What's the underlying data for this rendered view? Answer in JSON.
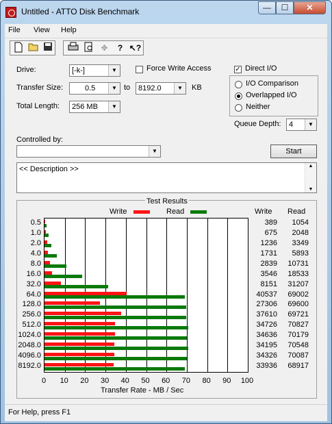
{
  "window": {
    "title": "Untitled - ATTO Disk Benchmark",
    "min": "—",
    "max": "☐",
    "close": "✕"
  },
  "menu": [
    "File",
    "View",
    "Help"
  ],
  "toolbar": {
    "icons": [
      "new-file-icon",
      "open-folder-icon",
      "save-icon",
      "print-icon",
      "print-preview-icon",
      "move-icon",
      "help-icon",
      "context-help-icon"
    ]
  },
  "form": {
    "drive_label": "Drive:",
    "drive_value": "[-k-]",
    "force_write_label": "Force Write Access",
    "force_write_checked": false,
    "direct_io_label": "Direct I/O",
    "direct_io_checked": true,
    "transfer_size_label": "Transfer Size:",
    "transfer_from": "0.5",
    "to_label": "to",
    "transfer_to": "8192.0",
    "kb_label": "KB",
    "total_length_label": "Total Length:",
    "total_length_value": "256 MB",
    "io_options": [
      "I/O Comparison",
      "Overlapped I/O",
      "Neither"
    ],
    "io_selected": 1,
    "queue_depth_label": "Queue Depth:",
    "queue_depth_value": "4",
    "controlled_by_label": "Controlled by:",
    "controlled_by_value": "",
    "start_label": "Start",
    "description": "<< Description >>"
  },
  "results": {
    "label": "Test Results",
    "write_legend": "Write",
    "read_legend": "Read",
    "write_col": "Write",
    "read_col": "Read"
  },
  "colors": {
    "write": "#ff1414",
    "read": "#0a7a0a"
  },
  "chart_data": {
    "type": "bar",
    "orientation": "horizontal",
    "xlabel": "Transfer Rate - MB / Sec",
    "xlim": [
      0,
      100
    ],
    "xticks": [
      0,
      10,
      20,
      30,
      40,
      50,
      60,
      70,
      80,
      90,
      100
    ],
    "categories": [
      "0.5",
      "1.0",
      "2.0",
      "4.0",
      "8.0",
      "16.0",
      "32.0",
      "64.0",
      "128.0",
      "256.0",
      "512.0",
      "1024.0",
      "2048.0",
      "4096.0",
      "8192.0"
    ],
    "series": [
      {
        "name": "Write",
        "values": [
          0.389,
          0.675,
          1.236,
          1.731,
          2.839,
          3.546,
          8.151,
          40.537,
          27.306,
          37.61,
          34.726,
          34.636,
          34.195,
          34.326,
          33.936
        ]
      },
      {
        "name": "Read",
        "values": [
          1.054,
          2.048,
          3.349,
          5.893,
          10.731,
          18.533,
          31.207,
          69.002,
          69.6,
          69.721,
          70.827,
          70.179,
          70.548,
          70.087,
          68.917
        ]
      }
    ],
    "write_table": [
      "389",
      "675",
      "1236",
      "1731",
      "2839",
      "3546",
      "8151",
      "40537",
      "27306",
      "37610",
      "34726",
      "34636",
      "34195",
      "34326",
      "33936"
    ],
    "read_table": [
      "1054",
      "2048",
      "3349",
      "5893",
      "10731",
      "18533",
      "31207",
      "69002",
      "69600",
      "69721",
      "70827",
      "70179",
      "70548",
      "70087",
      "68917"
    ],
    "grid": true
  },
  "status": {
    "text": "For Help, press F1"
  }
}
